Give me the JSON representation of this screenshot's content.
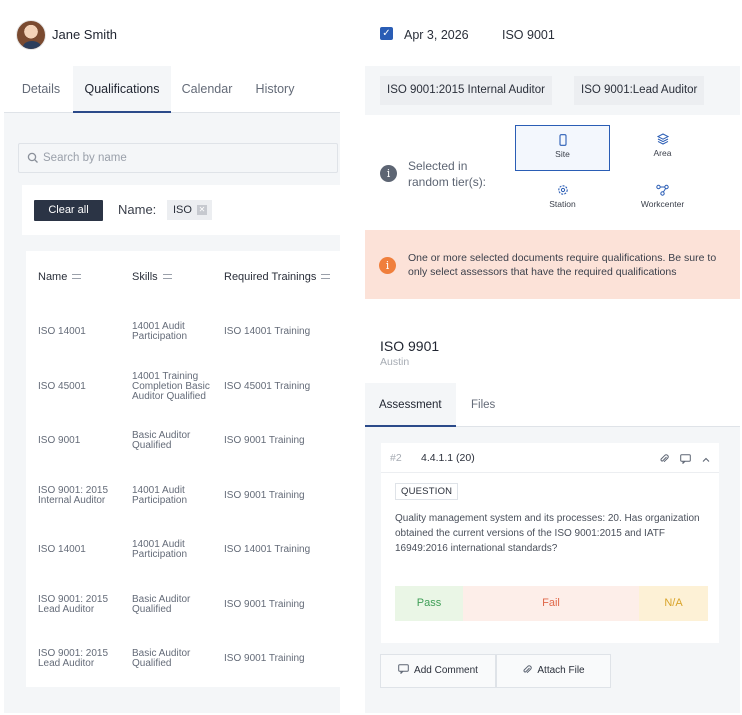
{
  "profile": {
    "name": "Jane Smith"
  },
  "tabs": [
    {
      "label": "Details"
    },
    {
      "label": "Qualifications",
      "active": true
    },
    {
      "label": "Calendar"
    },
    {
      "label": "History"
    }
  ],
  "search": {
    "placeholder": "Search by name"
  },
  "filters": {
    "clear_label": "Clear all",
    "name_label": "Name:",
    "chip": "ISO"
  },
  "table": {
    "headers": [
      "Name",
      "Skills",
      "Required Trainings"
    ],
    "rows": [
      {
        "name": [
          "ISO 14001"
        ],
        "skills": [
          "14001 Audit",
          "Participation"
        ],
        "training": "ISO 14001 Training"
      },
      {
        "name": [
          "ISO 45001"
        ],
        "skills": [
          "14001 Training",
          "Completion Basic",
          "Auditor Qualified"
        ],
        "training": "ISO 45001 Training"
      },
      {
        "name": [
          "ISO 9001"
        ],
        "skills": [
          "Basic Auditor",
          "Qualified"
        ],
        "training": "ISO 9001 Training"
      },
      {
        "name": [
          "ISO 9001: 2015",
          "Internal Auditor"
        ],
        "skills": [
          "14001 Audit",
          "Participation"
        ],
        "training": "ISO 9001 Training"
      },
      {
        "name": [
          "ISO 14001"
        ],
        "skills": [
          "14001 Audit",
          "Participation"
        ],
        "training": "ISO 14001 Training"
      },
      {
        "name": [
          "ISO 9001: 2015",
          "Lead Auditor"
        ],
        "skills": [
          "Basic Auditor",
          "Qualified"
        ],
        "training": "ISO 9001 Training"
      },
      {
        "name": [
          "ISO 9001: 2015",
          "Lead Auditor"
        ],
        "skills": [
          "Basic Auditor",
          "Qualified"
        ],
        "training": "ISO 9001 Training"
      }
    ]
  },
  "assignment": {
    "checked": true,
    "date": "Apr 3, 2026",
    "standard": "ISO 9001",
    "qualifications": [
      "ISO 9001:2015 Internal Auditor",
      "ISO 9001:Lead Auditor"
    ],
    "tier_label": "Selected in random tier(s):",
    "tiers": [
      {
        "label": "Site",
        "icon": "phone-icon",
        "selected": true
      },
      {
        "label": "Area",
        "icon": "layers-icon",
        "selected": false
      },
      {
        "label": "Station",
        "icon": "cog-icon",
        "selected": false
      },
      {
        "label": "Workcenter",
        "icon": "network-icon",
        "selected": false
      }
    ],
    "warning": "One or more selected documents require qualifications. Be sure to only select assessors that have the required qualifications",
    "info_glyph": "i"
  },
  "document": {
    "title": "ISO 9901",
    "location": "Austin",
    "tabs": [
      {
        "label": "Assessment",
        "active": true
      },
      {
        "label": "Files"
      }
    ],
    "question": {
      "number": "#2",
      "code": "4.4.1.1 (20)",
      "badge": "QUESTION",
      "text": "Quality management system and its processes: 20. Has organization obtained the current versions of the ISO 9001:2015 and IATF 16949:2016 international standards?",
      "answers": [
        {
          "label": "Pass",
          "color": "#3f9e57",
          "bg": "#eaf6e6"
        },
        {
          "label": "Fail",
          "color": "#e0684a",
          "bg": "#fdeee9"
        },
        {
          "label": "N/A",
          "color": "#d9a42a",
          "bg": "#fdf1d6"
        }
      ]
    },
    "actions": [
      {
        "label": "Add Comment"
      },
      {
        "label": "Attach File"
      }
    ]
  }
}
